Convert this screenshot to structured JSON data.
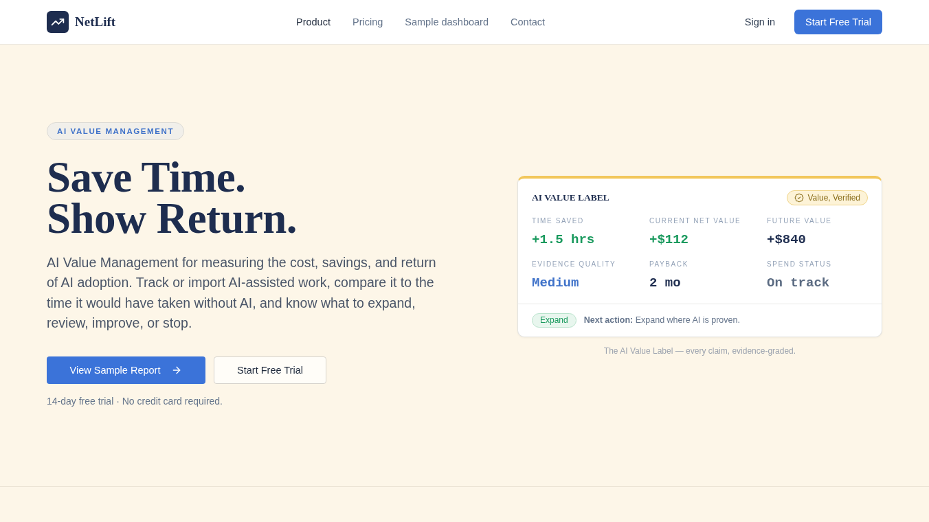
{
  "header": {
    "brand": "NetLift",
    "nav": [
      {
        "label": "Product",
        "selected": true
      },
      {
        "label": "Pricing",
        "selected": false
      },
      {
        "label": "Sample dashboard",
        "selected": false
      },
      {
        "label": "Contact",
        "selected": false
      }
    ],
    "sign_in": "Sign in",
    "cta": "Start Free Trial"
  },
  "hero": {
    "eyebrow": "AI VALUE MANAGEMENT",
    "headline": [
      "Save Time.",
      "Show Return."
    ],
    "description": "AI Value Management for measuring the cost, savings, and return of AI adoption. Track or import AI-assisted work, compare it to the time it would have taken without AI, and know what to expand, review, improve, or stop.",
    "primary_button": "View Sample Report",
    "secondary_button": "Start Free Trial",
    "note": "14-day free trial · No credit card required."
  },
  "value_label": {
    "title": "AI VALUE LABEL",
    "badge": "Value, Verified",
    "metrics": [
      {
        "label": "TIME SAVED",
        "value": "+1.5 hrs",
        "color": "#1a9a5e"
      },
      {
        "label": "CURRENT NET VALUE",
        "value": "+$112",
        "color": "#1a9a5e"
      },
      {
        "label": "FUTURE VALUE",
        "value": "+$840",
        "color": "#1e2d4f"
      },
      {
        "label": "EVIDENCE QUALITY",
        "value": "Medium",
        "color": "#3f72c9"
      },
      {
        "label": "PAYBACK",
        "value": "2 mo",
        "color": "#1e2d4f"
      },
      {
        "label": "SPEND STATUS",
        "value": "On track",
        "color": "#5b6b82"
      }
    ],
    "action_tag": "Expand",
    "next_action": "**Next action:** Expand where AI is proven.",
    "caption": "The AI Value Label — every claim, evidence-graded."
  }
}
